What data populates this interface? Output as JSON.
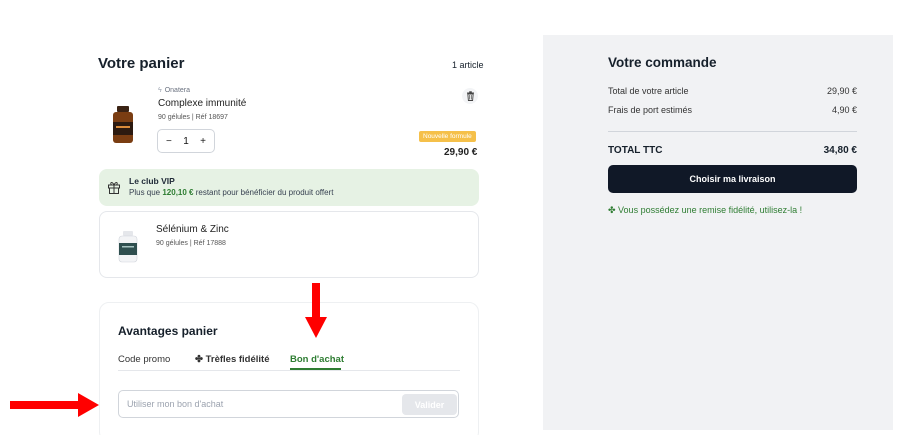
{
  "cart": {
    "title": "Votre panier",
    "count": "1 article",
    "item": {
      "brand": "Onatera",
      "name": "Complexe immunité",
      "meta": "90 gélules | Réf 18697",
      "qty": "1",
      "minus": "−",
      "plus": "+",
      "badge": "Nouvelle formule",
      "price": "29,90 €"
    },
    "vip": {
      "title": "Le club VIP",
      "text_before": "Plus que ",
      "amount": "120,10 €",
      "text_after": " restant pour bénéficier du produit offert"
    },
    "offer": {
      "name": "Sélénium & Zinc",
      "meta": "90 gélules | Réf 17888"
    }
  },
  "advantages": {
    "title": "Avantages panier",
    "tabs": [
      "Code promo",
      "Trèfles fidélité",
      "Bon d'achat"
    ],
    "active_tab": "Bon d'achat",
    "input_placeholder": "Utiliser mon bon d'achat",
    "validate_label": "Valider"
  },
  "summary": {
    "title": "Votre commande",
    "rows": [
      {
        "label": "Total de votre article",
        "value": "29,90 €"
      },
      {
        "label": "Frais de port estimés",
        "value": "4,90 €"
      }
    ],
    "total_label": "TOTAL TTC",
    "total_value": "34,80 €",
    "cta_label": "Choisir ma livraison",
    "loyalty_text": "Vous possédez une remise fidélité, utilisez-la !"
  },
  "colors": {
    "accent_green": "#2e7d32",
    "dark_button": "#101827",
    "badge_yellow": "#f5c04a",
    "annotation_red": "#ff0000"
  },
  "icons": [
    "bolt-icon",
    "trash-icon",
    "gift-icon",
    "clover-icon",
    "arrow-down-annotation",
    "arrow-right-annotation"
  ]
}
